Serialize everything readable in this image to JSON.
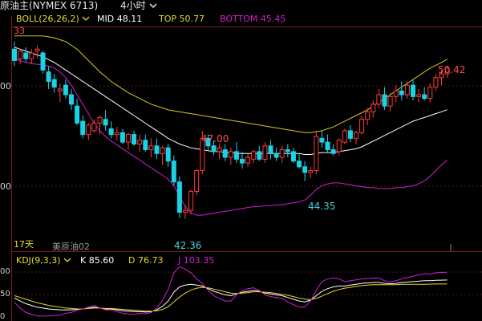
{
  "header": {
    "instrument": "原油主(NYMEX 6713)",
    "period": "4小时",
    "dropdown_arrow": "chevron-down-icon"
  },
  "legend_main": {
    "indicator": "BOLL(26,26,2)",
    "mid": "MID 48.11",
    "top": "TOP 50.77",
    "bottom": "BOTTOM 45.45"
  },
  "legend_kdj": {
    "indicator": "KDJ(9,3,3)",
    "k": "K 85.60",
    "d": "D 76.73",
    "j": "J 103.35"
  },
  "labels": {
    "corner_value": "33",
    "days": "17天",
    "source": "美原油02"
  },
  "axis_main": {
    "ticks": [
      "00",
      "00"
    ]
  },
  "axis_kdj": {
    "ticks": [
      "00",
      "50",
      "0"
    ]
  },
  "colors": {
    "background": "#000000",
    "up": "#ff3b3b",
    "down": "#19d2e6",
    "mid": "#ffffff",
    "top": "#d6c81e",
    "bottom": "#d21ed2",
    "k": "#ffffff",
    "d": "#e6dc28",
    "j": "#d21ed2",
    "price_label_up": "#ff4c4c",
    "price_label_down": "#4ad0e0"
  },
  "chart_data": [
    {
      "type": "candlestick",
      "name": "price",
      "ylim": [
        41.2,
        52.2
      ],
      "candles": [
        [
          51.3,
          51.7,
          50.4,
          50.7
        ],
        [
          50.8,
          51.3,
          50.5,
          51.2
        ],
        [
          51.1,
          51.4,
          50.6,
          50.8
        ],
        [
          50.8,
          51.3,
          50.5,
          51.1
        ],
        [
          51.2,
          51.5,
          50.8,
          51.3
        ],
        [
          51.1,
          51.2,
          50.0,
          50.2
        ],
        [
          50.1,
          50.4,
          49.2,
          49.6
        ],
        [
          49.7,
          50.0,
          49.0,
          49.3
        ],
        [
          49.1,
          49.5,
          48.5,
          49.2
        ],
        [
          49.4,
          49.7,
          48.7,
          48.9
        ],
        [
          48.9,
          49.2,
          48.1,
          48.4
        ],
        [
          48.3,
          48.7,
          47.3,
          47.4
        ],
        [
          47.5,
          47.8,
          46.6,
          46.8
        ],
        [
          46.8,
          47.4,
          46.5,
          47.3
        ],
        [
          47.0,
          47.6,
          46.9,
          47.4
        ],
        [
          47.4,
          47.8,
          46.8,
          47.7
        ],
        [
          47.6,
          48.1,
          47.0,
          47.3
        ],
        [
          47.1,
          47.5,
          46.6,
          46.8
        ],
        [
          46.8,
          47.2,
          46.5,
          46.9
        ],
        [
          46.9,
          47.1,
          46.3,
          46.4
        ],
        [
          46.4,
          46.9,
          46.0,
          46.8
        ],
        [
          46.8,
          47.0,
          46.2,
          46.3
        ],
        [
          46.3,
          46.8,
          45.9,
          46.5
        ],
        [
          46.5,
          46.8,
          45.9,
          46.0
        ],
        [
          46.0,
          46.6,
          45.6,
          46.2
        ],
        [
          46.2,
          46.6,
          45.5,
          45.8
        ],
        [
          45.8,
          46.2,
          45.2,
          46.1
        ],
        [
          46.1,
          46.3,
          45.1,
          45.4
        ],
        [
          45.4,
          45.7,
          44.1,
          44.3
        ],
        [
          44.3,
          44.6,
          42.4,
          42.7
        ],
        [
          42.7,
          43.1,
          42.36,
          42.8
        ],
        [
          42.8,
          43.9,
          42.6,
          43.8
        ],
        [
          43.8,
          45.0,
          43.6,
          44.9
        ],
        [
          44.9,
          47.0,
          44.7,
          46.6
        ],
        [
          46.6,
          46.8,
          46.0,
          46.2
        ],
        [
          46.2,
          46.5,
          45.7,
          45.9
        ],
        [
          45.9,
          46.3,
          45.5,
          46.1
        ],
        [
          46.0,
          46.3,
          45.4,
          45.6
        ],
        [
          45.6,
          46.1,
          45.2,
          45.9
        ],
        [
          45.9,
          46.4,
          45.3,
          45.5
        ],
        [
          45.5,
          45.9,
          45.0,
          45.3
        ],
        [
          45.3,
          45.8,
          45.1,
          45.6
        ],
        [
          45.5,
          46.0,
          45.3,
          45.9
        ],
        [
          45.9,
          46.2,
          45.4,
          45.5
        ],
        [
          45.5,
          46.4,
          45.3,
          46.2
        ],
        [
          46.2,
          46.5,
          45.5,
          45.8
        ],
        [
          45.8,
          46.1,
          45.4,
          45.6
        ],
        [
          45.6,
          46.2,
          45.3,
          46.0
        ],
        [
          46.0,
          46.3,
          45.6,
          45.9
        ],
        [
          45.9,
          46.1,
          45.3,
          45.4
        ],
        [
          45.4,
          45.8,
          45.0,
          45.1
        ],
        [
          45.1,
          45.4,
          44.35,
          44.8
        ],
        [
          44.8,
          45.1,
          44.5,
          44.9
        ],
        [
          44.9,
          47.0,
          44.7,
          46.7
        ],
        [
          46.6,
          47.0,
          46.1,
          46.4
        ],
        [
          46.4,
          46.8,
          45.8,
          46.0
        ],
        [
          46.0,
          46.3,
          45.7,
          45.8
        ],
        [
          45.9,
          46.6,
          45.7,
          46.5
        ],
        [
          46.4,
          47.1,
          46.3,
          47.0
        ],
        [
          47.0,
          47.3,
          46.4,
          46.6
        ],
        [
          46.6,
          47.0,
          46.3,
          46.9
        ],
        [
          46.9,
          47.8,
          46.8,
          47.6
        ],
        [
          47.6,
          48.2,
          47.3,
          48.0
        ],
        [
          48.0,
          48.6,
          47.7,
          48.4
        ],
        [
          48.4,
          49.2,
          48.2,
          48.9
        ],
        [
          48.9,
          49.3,
          48.1,
          48.3
        ],
        [
          48.3,
          49.0,
          48.0,
          48.8
        ],
        [
          48.8,
          49.4,
          48.5,
          49.1
        ],
        [
          49.1,
          49.6,
          48.6,
          48.9
        ],
        [
          48.9,
          49.6,
          48.7,
          49.4
        ],
        [
          49.4,
          49.7,
          48.6,
          48.8
        ],
        [
          48.8,
          49.2,
          48.5,
          48.9
        ],
        [
          48.9,
          49.3,
          48.6,
          48.7
        ],
        [
          48.7,
          49.5,
          48.5,
          49.3
        ],
        [
          49.3,
          50.0,
          49.1,
          49.8
        ],
        [
          49.8,
          50.2,
          49.4,
          50.0
        ],
        [
          50.0,
          50.42,
          49.8,
          50.3
        ]
      ],
      "candle_fields": [
        "open",
        "high",
        "low",
        "close"
      ],
      "annotations": [
        {
          "label": "50.42",
          "candle_index": 76,
          "kind": "high"
        },
        {
          "label": "47.00",
          "candle_index": 33,
          "kind": "high"
        },
        {
          "label": "44.35",
          "candle_index": 51,
          "kind": "low"
        },
        {
          "label": "42.36",
          "candle_index": 30,
          "kind": "low"
        }
      ],
      "boll": {
        "mid_last": 48.11,
        "top_last": 50.77,
        "bottom_last": 45.45,
        "mid": [
          51.4,
          51.3,
          51.2,
          51.1,
          51.0,
          50.9,
          50.75,
          50.6,
          50.4,
          50.2,
          50.0,
          49.8,
          49.6,
          49.4,
          49.2,
          49.0,
          48.8,
          48.6,
          48.4,
          48.2,
          48.0,
          47.8,
          47.6,
          47.4,
          47.2,
          47.0,
          46.8,
          46.6,
          46.45,
          46.3,
          46.2,
          46.1,
          46.05,
          46.0,
          45.95,
          45.9,
          45.9,
          45.85,
          45.85,
          45.8,
          45.8,
          45.8,
          45.8,
          45.8,
          45.8,
          45.8,
          45.8,
          45.8,
          45.8,
          45.8,
          45.8,
          45.75,
          45.75,
          45.8,
          45.85,
          45.85,
          45.85,
          45.9,
          45.95,
          46.0,
          46.05,
          46.15,
          46.3,
          46.45,
          46.6,
          46.75,
          46.9,
          47.05,
          47.2,
          47.35,
          47.5,
          47.6,
          47.7,
          47.8,
          47.9,
          48.0,
          48.11
        ],
        "top": [
          52.0,
          52.0,
          52.0,
          52.0,
          52.0,
          52.0,
          51.95,
          51.9,
          51.8,
          51.7,
          51.5,
          51.3,
          51.0,
          50.7,
          50.4,
          50.1,
          49.85,
          49.6,
          49.4,
          49.2,
          49.0,
          48.85,
          48.7,
          48.55,
          48.4,
          48.3,
          48.2,
          48.1,
          48.05,
          48.0,
          47.95,
          47.9,
          47.85,
          47.8,
          47.75,
          47.7,
          47.65,
          47.6,
          47.55,
          47.5,
          47.45,
          47.4,
          47.35,
          47.3,
          47.25,
          47.2,
          47.15,
          47.1,
          47.05,
          47.0,
          46.95,
          46.9,
          46.9,
          46.95,
          47.0,
          47.1,
          47.2,
          47.35,
          47.5,
          47.65,
          47.8,
          47.95,
          48.1,
          48.3,
          48.5,
          48.7,
          48.9,
          49.1,
          49.3,
          49.5,
          49.7,
          49.9,
          50.1,
          50.3,
          50.45,
          50.6,
          50.77
        ],
        "bottom": [
          50.8,
          50.7,
          50.6,
          50.55,
          50.5,
          50.5,
          50.4,
          50.3,
          50.1,
          49.8,
          49.4,
          48.9,
          48.4,
          47.9,
          47.4,
          47.0,
          46.7,
          46.45,
          46.25,
          46.05,
          45.85,
          45.65,
          45.45,
          45.25,
          45.05,
          44.85,
          44.65,
          44.45,
          44.1,
          43.55,
          43.0,
          42.65,
          42.55,
          42.55,
          42.6,
          42.65,
          42.7,
          42.75,
          42.8,
          42.85,
          42.9,
          42.95,
          43.0,
          43.0,
          43.05,
          43.05,
          43.1,
          43.1,
          43.15,
          43.2,
          43.25,
          43.35,
          43.6,
          43.9,
          44.1,
          44.2,
          44.25,
          44.25,
          44.2,
          44.15,
          44.1,
          44.05,
          44.0,
          44.0,
          43.95,
          43.95,
          43.95,
          44.0,
          44.0,
          44.05,
          44.1,
          44.2,
          44.35,
          44.6,
          44.9,
          45.2,
          45.45
        ]
      }
    },
    {
      "type": "line",
      "name": "KDJ",
      "ylim": [
        0,
        120
      ],
      "series": [
        {
          "name": "K",
          "last": 85.6,
          "values": [
            45,
            38,
            32,
            28,
            24,
            22,
            20,
            19,
            18,
            18,
            18,
            19,
            20,
            22,
            24,
            22,
            20,
            20,
            18,
            16,
            15,
            14,
            14,
            13,
            14,
            18,
            26,
            38,
            58,
            70,
            74,
            76,
            74,
            72,
            66,
            60,
            56,
            52,
            50,
            54,
            58,
            60,
            62,
            60,
            56,
            54,
            52,
            50,
            46,
            42,
            38,
            36,
            40,
            50,
            60,
            66,
            70,
            72,
            72,
            74,
            76,
            78,
            79,
            80,
            80,
            78,
            77,
            78,
            80,
            81,
            82,
            83,
            84,
            84,
            85,
            85.3,
            85.6
          ]
        },
        {
          "name": "D",
          "last": 76.73,
          "values": [
            50,
            46,
            42,
            38,
            34,
            31,
            28,
            26,
            24,
            22,
            21,
            20,
            20,
            21,
            22,
            22,
            21,
            21,
            20,
            19,
            18,
            17,
            16,
            15,
            15,
            16,
            19,
            25,
            36,
            47,
            56,
            63,
            67,
            69,
            68,
            65,
            62,
            59,
            56,
            55,
            56,
            57,
            59,
            59,
            58,
            57,
            55,
            53,
            51,
            48,
            45,
            42,
            41,
            44,
            49,
            55,
            60,
            64,
            67,
            69,
            71,
            73,
            74,
            75,
            75,
            75,
            75,
            75,
            76,
            76,
            76,
            76,
            76,
            76.3,
            76.5,
            76.6,
            76.73
          ]
        },
        {
          "name": "J",
          "last": 103.35,
          "values": [
            35,
            22,
            12,
            8,
            4,
            4,
            4,
            5,
            6,
            10,
            12,
            17,
            20,
            24,
            28,
            22,
            18,
            18,
            14,
            10,
            9,
            8,
            10,
            9,
            12,
            22,
            40,
            64,
            102,
            116,
            110,
            102,
            88,
            78,
            62,
            50,
            44,
            38,
            38,
            52,
            62,
            66,
            68,
            62,
            52,
            48,
            46,
            44,
            36,
            30,
            24,
            24,
            38,
            62,
            82,
            88,
            90,
            88,
            82,
            84,
            86,
            88,
            89,
            90,
            90,
            84,
            81,
            84,
            88,
            91,
            94,
            97,
            100,
            99,
            102,
            102.7,
            103.35
          ]
        }
      ]
    }
  ]
}
